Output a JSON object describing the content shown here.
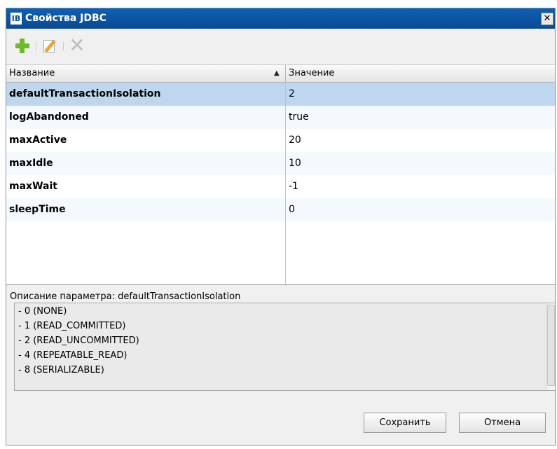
{
  "window": {
    "logo_text": "IB",
    "title": "Свойства JDBC",
    "close_label": "✕"
  },
  "toolbar": {
    "icons": [
      "add-icon",
      "edit-icon",
      "delete-icon"
    ]
  },
  "table": {
    "columns": {
      "name": "Название",
      "value": "Значение"
    },
    "sort_indicator": "▲",
    "rows": [
      {
        "name": "defaultTransactionIsolation",
        "value": "2"
      },
      {
        "name": "logAbandoned",
        "value": "true"
      },
      {
        "name": "maxActive",
        "value": "20"
      },
      {
        "name": "maxIdle",
        "value": "10"
      },
      {
        "name": "maxWait",
        "value": "-1"
      },
      {
        "name": "sleepTime",
        "value": "0"
      }
    ],
    "selected_row": "defaultTransactionIsolation"
  },
  "description": {
    "label": "Описание параметра: defaultTransactionIsolation",
    "lines": [
      "- 0 (NONE)",
      "- 1 (READ_COMMITTED)",
      "- 2 (READ_UNCOMMITTED)",
      "- 4 (REPEATABLE_READ)",
      "- 8 (SERIALIZABLE)"
    ]
  },
  "buttons": {
    "save": "Сохранить",
    "cancel": "Отмена"
  },
  "colors": {
    "titlebar": "#0a4a93",
    "selected_row": "#bed7ef",
    "add_icon": "#6fba2c"
  }
}
